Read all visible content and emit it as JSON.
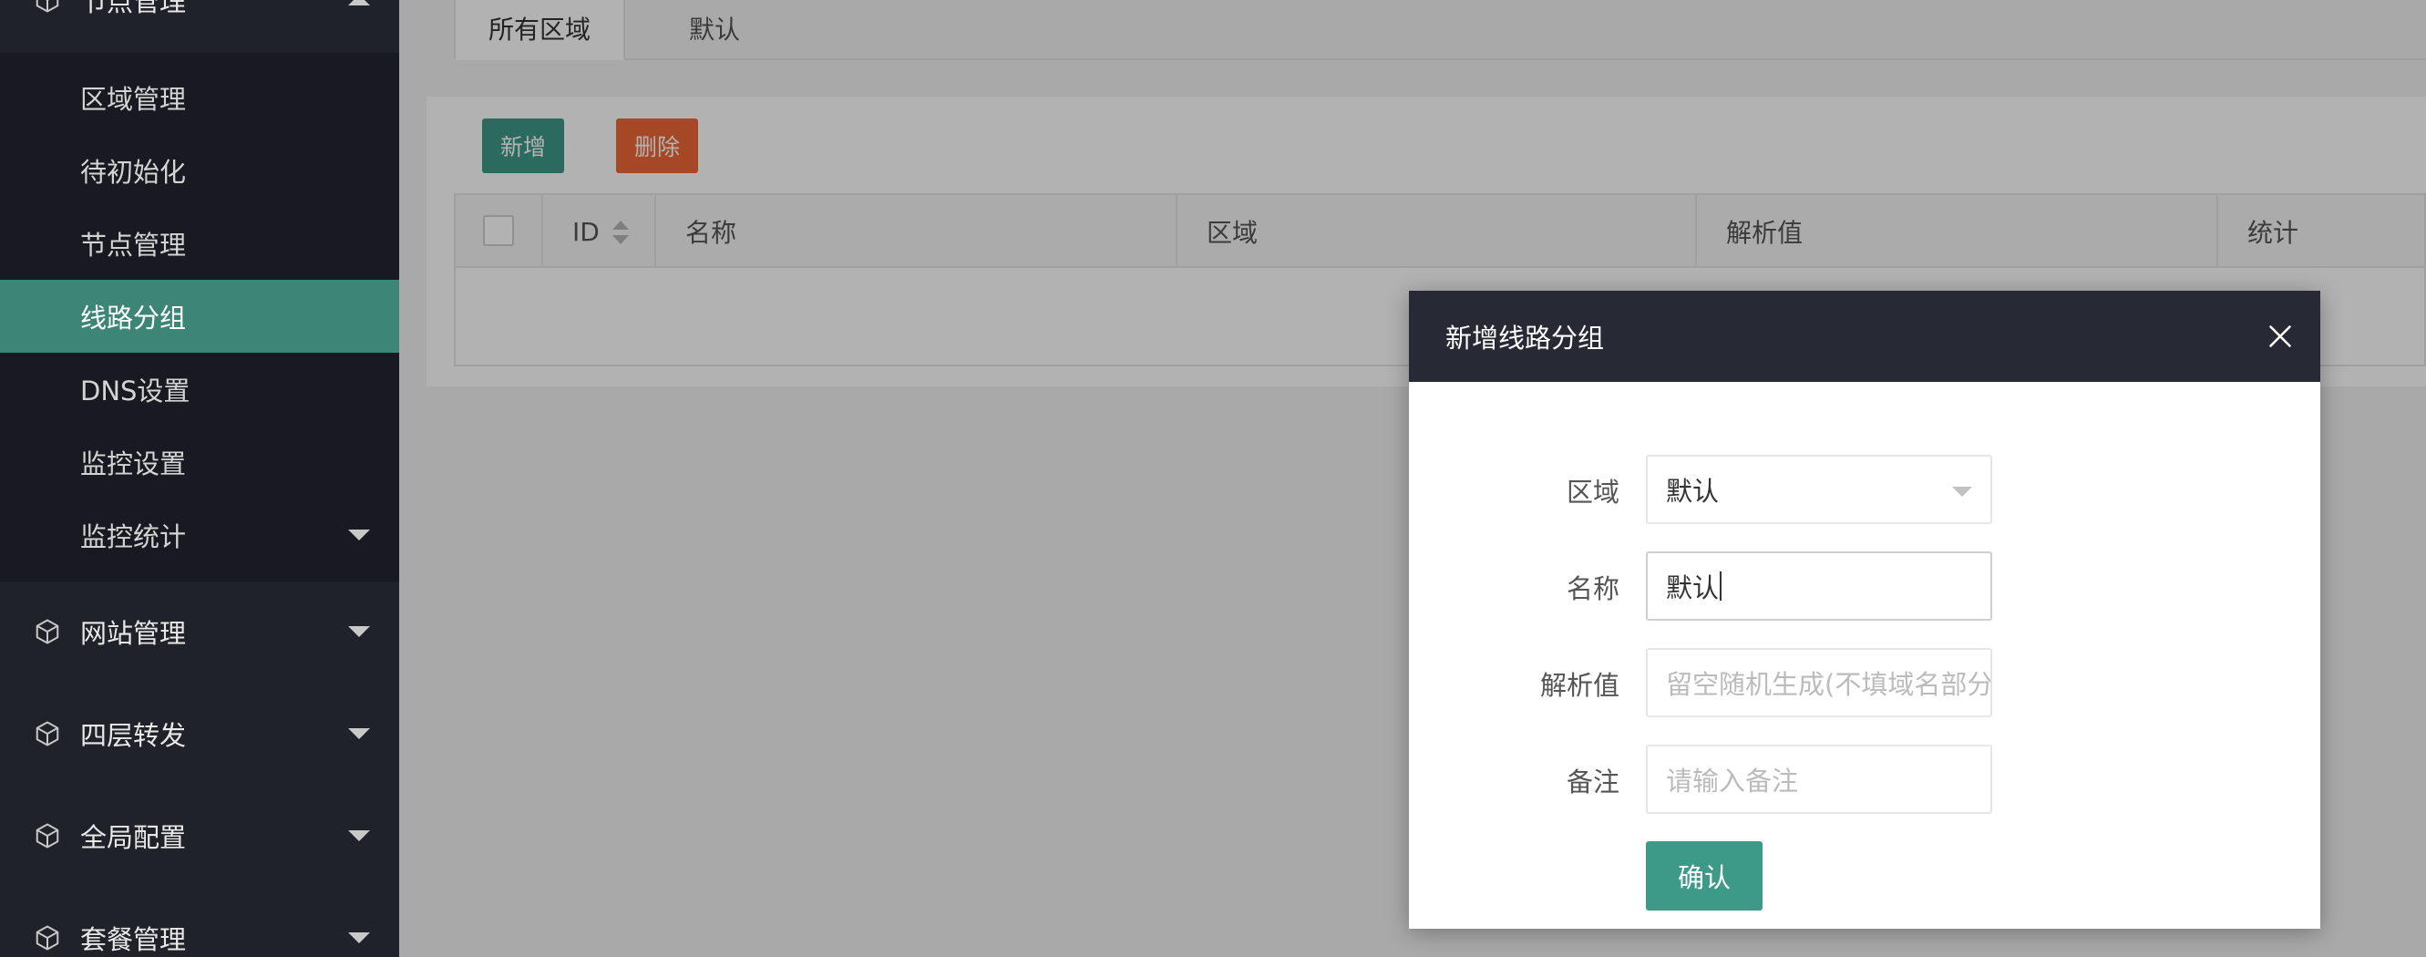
{
  "sidebar": {
    "node_group": "节点管理",
    "sub_items": [
      "区域管理",
      "待初始化",
      "节点管理",
      "线路分组",
      "DNS设置",
      "监控设置",
      "监控统计"
    ],
    "active_item": "线路分组",
    "groups": [
      "网站管理",
      "四层转发",
      "全局配置",
      "套餐管理"
    ]
  },
  "main": {
    "tabs": [
      "所有区域",
      "默认"
    ],
    "toolbar": {
      "add_label": "新增",
      "delete_label": "删除"
    },
    "table_headers": [
      "ID",
      "名称",
      "区域",
      "解析值",
      "统计"
    ]
  },
  "modal": {
    "title": "新增线路分组",
    "fields": {
      "region_label": "区域",
      "region_value": "默认",
      "name_label": "名称",
      "name_value": "默认",
      "resolve_label": "解析值",
      "resolve_placeholder": "留空随机生成(不填域名部分)",
      "remark_label": "备注",
      "remark_placeholder": "请输入备注"
    },
    "confirm_label": "确认"
  },
  "colors": {
    "sidebar_bg": "#20222a",
    "active_bg": "#3d8577",
    "primary": "#3d9988",
    "danger": "#ee6737",
    "modal_header": "#272a35"
  }
}
